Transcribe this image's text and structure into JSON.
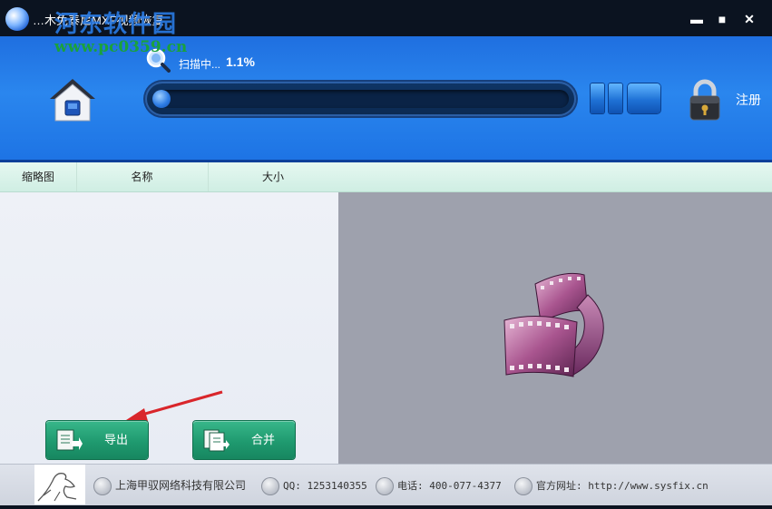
{
  "window": {
    "title": "…木免泰尼MXF视频恢复",
    "watermark_cn": "河东软件园",
    "watermark_url": "www.pc0359.cn",
    "minimize": "▬",
    "maximize": "■",
    "close": "✕"
  },
  "toolbar": {
    "scan_status": "扫描中...",
    "scan_percent": "1.1%",
    "progress_fraction": 0.011,
    "register_label": "注册"
  },
  "columns": {
    "thumbnail": "缩略图",
    "name": "名称",
    "size": "大小"
  },
  "buttons": {
    "export_label": "导出",
    "merge_label": "合并"
  },
  "footer": {
    "company": "上海甲驭网络科技有限公司",
    "qq": "QQ: 1253140355",
    "phone": "电话: 400-077-4377",
    "website": "官方网址: http://www.sysfix.cn"
  },
  "colors": {
    "toolbar_blue": "#2a86ee",
    "button_green": "#1f9a6f",
    "arrow_red": "#d9262b",
    "header_mint": "#d8f2e8"
  },
  "icons": [
    "app-icon",
    "home-icon",
    "search-icon",
    "pause-icon",
    "stop-icon",
    "lock-icon",
    "film-reel-icon",
    "export-icon",
    "merge-icon",
    "building-icon",
    "qq-icon",
    "phone-icon",
    "globe-icon"
  ]
}
